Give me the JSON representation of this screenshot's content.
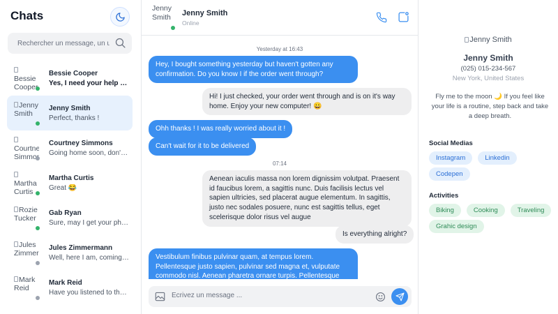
{
  "sidebar": {
    "title": "Chats",
    "search_placeholder": "Rechercher un message, un utilisateur...",
    "chats": [
      {
        "avatar_alt": "Bessie Cooper",
        "name": "Bessie Cooper",
        "preview": "Yes, I need your help with the project",
        "status_color": "#34b36b",
        "unread": true,
        "active": false
      },
      {
        "avatar_alt": "Jenny Smith",
        "name": "Jenny Smith",
        "preview": "Perfect, thanks !",
        "status_color": "#34b36b",
        "unread": false,
        "active": true
      },
      {
        "avatar_alt": "Courtney Simmons",
        "name": "Courtney Simmons",
        "preview": "Going home soon, don't worry",
        "status_color": "#9ca3af",
        "unread": false,
        "active": false
      },
      {
        "avatar_alt": "Martha Curtis",
        "name": "Martha Curtis",
        "preview": "Great 😂",
        "status_color": "#34b36b",
        "unread": false,
        "active": false
      },
      {
        "avatar_alt": "Rozie Tucker",
        "name": "Gab Ryan",
        "preview": "Sure, may I get your phone number?",
        "status_color": "#34b36b",
        "unread": false,
        "active": false
      },
      {
        "avatar_alt": "Jules Zimmermann",
        "name": "Jules Zimmermann",
        "preview": "Well, here I am, coming soon",
        "status_color": "#9ca3af",
        "unread": false,
        "active": false
      },
      {
        "avatar_alt": "Mark Reid",
        "name": "Mark Reid",
        "preview": "Have you listened to the new song?",
        "status_color": "#9ca3af",
        "unread": false,
        "active": false
      }
    ]
  },
  "conversation": {
    "header": {
      "avatar_alt": "Jenny Smith",
      "name": "Jenny Smith",
      "status": "Online"
    },
    "timestamps": [
      "Yesterday at 16:43",
      "07:14"
    ],
    "messages": [
      {
        "dir": "out",
        "text": "Hey, I bought something yesterday but haven't gotten any confirmation. Do you know I if the order went through?"
      },
      {
        "dir": "in",
        "text": "Hi! I just checked, your order went through and is on it's way home. Enjoy your new computer! 😀"
      },
      {
        "dir": "out",
        "text": "Ohh thanks ! I was really worried about it !"
      },
      {
        "dir": "out",
        "text": "Can't wait for it to be delivered"
      },
      {
        "dir": "in",
        "text": "Aenean iaculis massa non lorem dignissim volutpat. Praesent id faucibus lorem, a sagittis nunc. Duis facilisis lectus vel sapien ultricies, sed placerat augue elementum. In sagittis, justo nec sodales posuere, nunc est sagittis tellus, eget scelerisque dolor risus vel augue"
      },
      {
        "dir": "in",
        "text": "Is everything alright?"
      },
      {
        "dir": "out",
        "text": "Vestibulum finibus pulvinar quam, at tempus lorem. Pellentesque justo sapien, pulvinar sed magna et, vulputate commodo nisl. Aenean pharetra ornare turpis. Pellentesque viverra blandit"
      }
    ],
    "composer_placeholder": "Ecrivez un message ..."
  },
  "profile": {
    "avatar_alt": "Jenny Smith",
    "name": "Jenny Smith",
    "phone": "(025) 015-234-567",
    "location": "New York, United States",
    "quote": "Fly me to the moon 🌙 If you feel like your life is a routine, step back and take a deep breath.",
    "social_title": "Social Medias",
    "social": [
      "Instagram",
      "Linkedin",
      "Codepen"
    ],
    "activities_title": "Activities",
    "activities": [
      "Biking",
      "Cooking",
      "Traveling",
      "Grahic design"
    ]
  },
  "colors": {
    "accent": "#3b8ff0",
    "online": "#34b36b",
    "offline": "#9ca3af",
    "active_chat_bg": "#e7f1fd"
  },
  "icons": {
    "theme_toggle": "moon-icon",
    "search": "search-icon",
    "call": "phone-icon",
    "new_message": "new-message-icon",
    "attach": "image-icon",
    "emoji": "smiley-icon",
    "send": "send-icon"
  }
}
